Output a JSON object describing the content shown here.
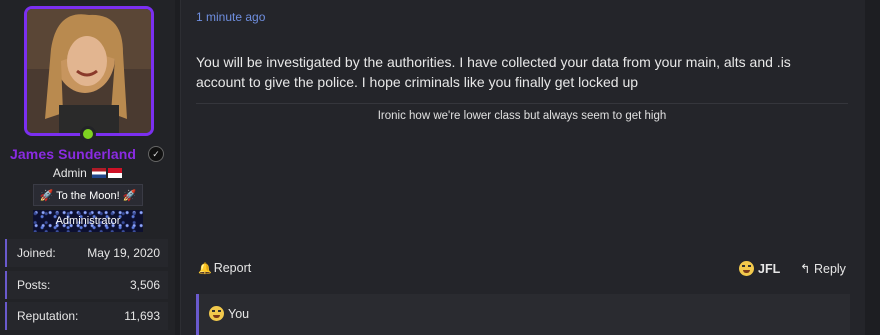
{
  "user": {
    "username": "James Sunderland",
    "title": "Admin",
    "banners": [
      "🚀 To the Moon! 🚀",
      "Administrator"
    ],
    "stats": [
      {
        "label": "Joined:",
        "value": "May 19, 2020"
      },
      {
        "label": "Posts:",
        "value": "3,506"
      },
      {
        "label": "Reputation:",
        "value": "11,693"
      }
    ]
  },
  "post": {
    "timestamp": "1 minute ago",
    "message": "You will be investigated by the authorities. I have collected your data from your main, alts and .is account to give the police. I hope criminals like you finally get locked up",
    "signature": "Ironic how we're lower class but always seem to get high"
  },
  "actions": {
    "report_label": "Report",
    "jfl_label": "JFL",
    "reply_label": "Reply"
  },
  "reactions": {
    "text": "You"
  },
  "colors": {
    "accent_purple": "#8a2be2",
    "avatar_border": "#7b2ff0",
    "online": "#7ed321",
    "timestamp": "#6f8fe0"
  }
}
